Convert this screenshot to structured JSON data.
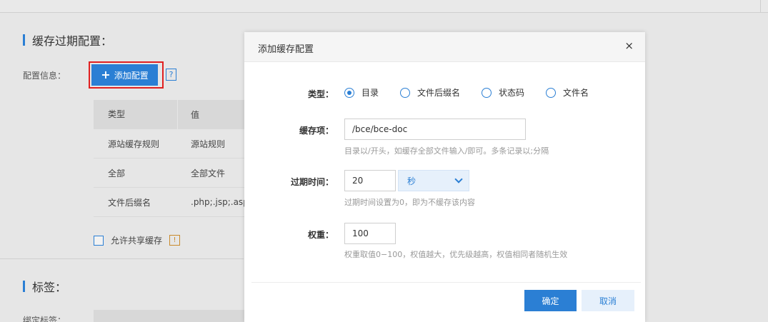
{
  "background": {
    "section_cache": "缓存过期配置：",
    "config_label": "配置信息：",
    "add_button": "添加配置",
    "help_glyph": "?",
    "table": {
      "headers": [
        "类型",
        "值"
      ],
      "rows": [
        [
          "源站缓存规则",
          "源站规则"
        ],
        [
          "全部",
          "全部文件"
        ],
        [
          "文件后缀名",
          ".php;.jsp;.asp"
        ]
      ]
    },
    "share_cache": "允许共享缓存",
    "share_warn_glyph": "!",
    "section_tags": "标签：",
    "bind_tags_label": "绑定标签："
  },
  "modal": {
    "title": "添加缓存配置",
    "close_glyph": "×",
    "type_label": "类型：",
    "type_options": [
      "目录",
      "文件后缀名",
      "状态码",
      "文件名"
    ],
    "type_selected": "目录",
    "cache_item_label": "缓存项：",
    "cache_item_value": "/bce/bce-doc",
    "cache_item_hint": "目录以/开头，如缓存全部文件输入/即可。多条记录以;分隔",
    "expire_label": "过期时间：",
    "expire_value": "20",
    "expire_unit": "秒",
    "expire_hint": "过期时间设置为0，即为不缓存该内容",
    "weight_label": "权重：",
    "weight_value": "100",
    "weight_hint": "权重取值0−100，权值越大，优先级越高，权值相同者随机生效",
    "ok_button": "确定",
    "cancel_button": "取消"
  },
  "colors": {
    "accent": "#2b7fd4",
    "highlight_border": "#e02020",
    "hint_text": "#999999"
  }
}
